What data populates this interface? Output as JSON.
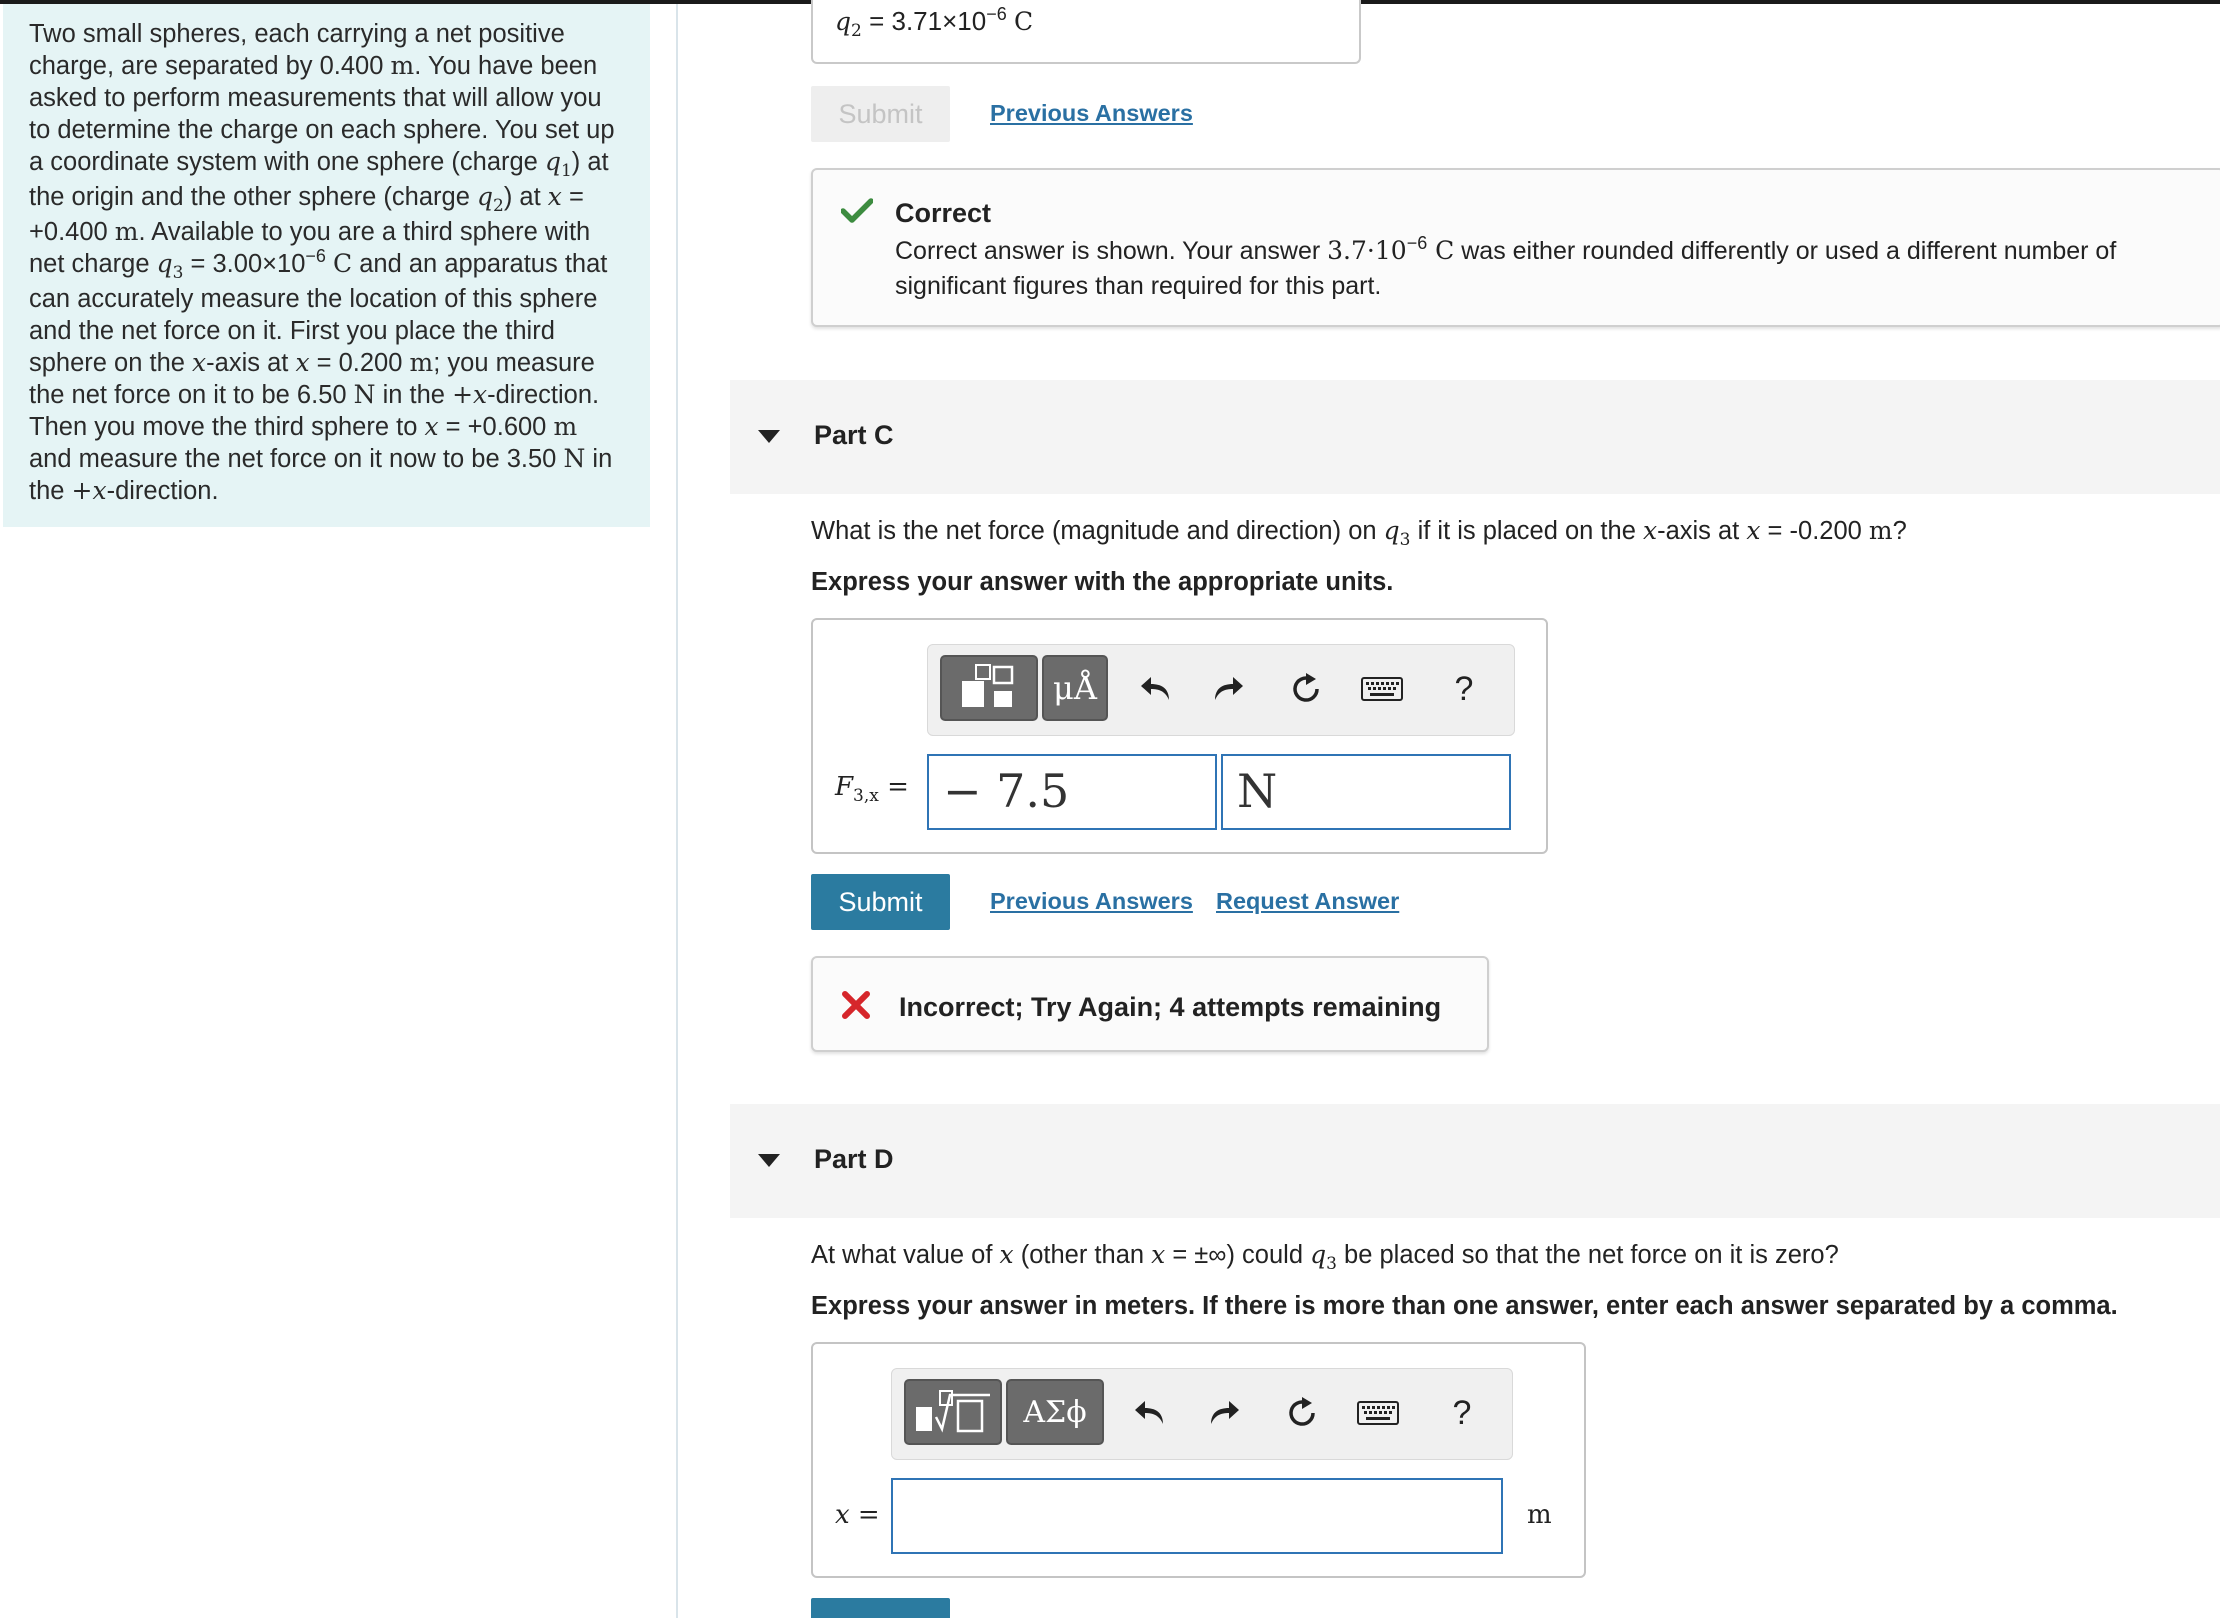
{
  "problem": {
    "text_parts": {
      "p1": "Two small spheres, each carrying a net positive charge, are separated by 0.400 ",
      "m": "m",
      "p2": ". You have been asked to perform measurements that will allow you to determine the charge on each sphere. You set up a coordinate system with one sphere (charge ",
      "q": "q",
      "one": "1",
      "p3": ") at the origin and the other sphere (charge ",
      "two": "2",
      "p4": ") at ",
      "x": "x",
      "p5": " = +0.400 ",
      "p6": ". Available to you are a third sphere with net charge ",
      "three": "3",
      "p7": " = 3.00×10",
      "exp": "−6",
      "C": "C",
      "p8": " and an apparatus that can accurately measure the location of this sphere and the net force on it. First you place the third sphere on the ",
      "p9": "-axis at ",
      "p10": " = 0.200 ",
      "p11": "; you measure the net force on it to be 6.50 ",
      "N": "N",
      "p12": " in the ",
      "plusx": "+x",
      "p13": "-direction. Then you move the third sphere to ",
      "p14": " = +0.600 ",
      "p15": " and measure the net force on it now to be 3.50 ",
      "p16": " in the ",
      "p17": "-direction."
    }
  },
  "part_b": {
    "answer_label_q": "q",
    "answer_label_sub": "2",
    "answer_equals": " = ",
    "answer_value": "3.71×10",
    "answer_exp": "−6",
    "answer_unit": "C",
    "submit_label": "Submit",
    "previous_answers_label": "Previous Answers",
    "feedback": {
      "title": "Correct",
      "msg_a": "Correct answer is shown. Your answer ",
      "msg_value": "3.7·10",
      "msg_exp": "−6",
      "msg_unit": " C",
      "msg_b": " was either rounded differently or used a different number of significant figures than required for this part.",
      "color": "#3d8c40"
    }
  },
  "part_c": {
    "title": "Part C",
    "question_a": "What is the net force (magnitude and direction) on ",
    "question_q": "q",
    "question_sub": "3",
    "question_b": " if it is placed on the ",
    "question_x": "x",
    "question_c": "-axis at ",
    "question_d": " = -0.200 ",
    "question_m": "m",
    "question_e": "?",
    "instruction": "Express your answer with the appropriate units.",
    "toolbar": {
      "template_icon": "templates-icon",
      "units_label": "μÅ",
      "undo_icon": "undo-icon",
      "redo_icon": "redo-icon",
      "reset_icon": "reset-icon",
      "keyboard_icon": "keyboard-icon",
      "help_label": "?"
    },
    "field_label_F": "F",
    "field_label_sub": "3,x",
    "field_label_eq": " =",
    "value_input": "− 7.5",
    "unit_input": "N",
    "submit_label": "Submit",
    "previous_answers_label": "Previous Answers",
    "request_answer_label": "Request Answer",
    "feedback": {
      "title": "Incorrect; Try Again; 4 attempts remaining",
      "color": "#d6262b"
    }
  },
  "part_d": {
    "title": "Part D",
    "question_a": "At what value of ",
    "question_x": "x",
    "question_b": " (other than ",
    "question_c": " = ±∞) could ",
    "question_q": "q",
    "question_sub": "3",
    "question_d": " be placed so that the net force on it is zero?",
    "instruction": "Express your answer in meters. If there is more than one answer, enter each answer separated by a comma.",
    "toolbar": {
      "template_icon": "sqrt-template-icon",
      "symbols_label": "ΑΣϕ",
      "undo_icon": "undo-icon",
      "redo_icon": "redo-icon",
      "reset_icon": "reset-icon",
      "keyboard_icon": "keyboard-icon",
      "help_label": "?"
    },
    "field_label": "x",
    "field_label_eq": " =",
    "value_input": "",
    "unit": "m"
  }
}
